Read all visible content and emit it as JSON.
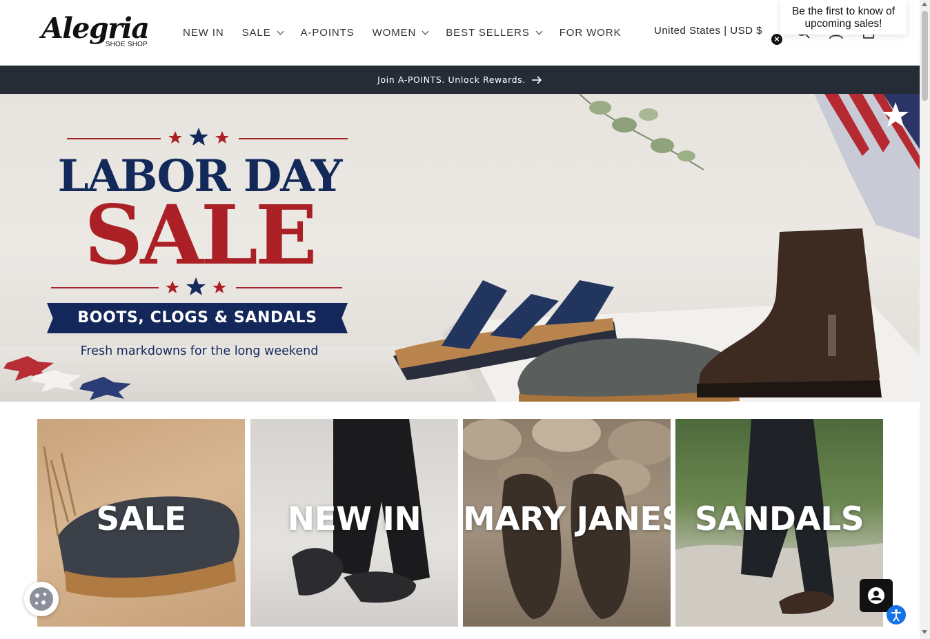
{
  "brand": {
    "logo_main": "Alegria",
    "logo_sub": "SHOE SHOP"
  },
  "nav": {
    "items": [
      {
        "label": "NEW IN",
        "has_dropdown": false
      },
      {
        "label": "SALE",
        "has_dropdown": true
      },
      {
        "label": "A-POINTS",
        "has_dropdown": false
      },
      {
        "label": "WOMEN",
        "has_dropdown": true
      },
      {
        "label": "BEST SELLERS",
        "has_dropdown": true
      },
      {
        "label": "FOR WORK",
        "has_dropdown": false
      }
    ],
    "country_selector": "United States | USD $",
    "icons": [
      "search-icon",
      "account-icon",
      "cart-icon"
    ]
  },
  "popup": {
    "message": "Be the first to know of upcoming sales!",
    "close_glyph": "×"
  },
  "announcement": {
    "text": "Join A-POINTS. Unlock Rewards."
  },
  "hero": {
    "line1": "LABOR DAY",
    "line2": "SALE",
    "banner": "BOOTS, CLOGS & SANDALS",
    "subtext": "Fresh markdowns for the long weekend",
    "colors": {
      "navy": "#12295a",
      "red": "#ab2025"
    }
  },
  "categories": [
    {
      "label": "SALE"
    },
    {
      "label": "NEW IN"
    },
    {
      "label": "MARY JANES"
    },
    {
      "label": "SANDALS"
    }
  ],
  "widgets": {
    "cookie": "cookie-icon",
    "chat": "chat-account-icon",
    "accessibility": "accessibility-icon"
  }
}
